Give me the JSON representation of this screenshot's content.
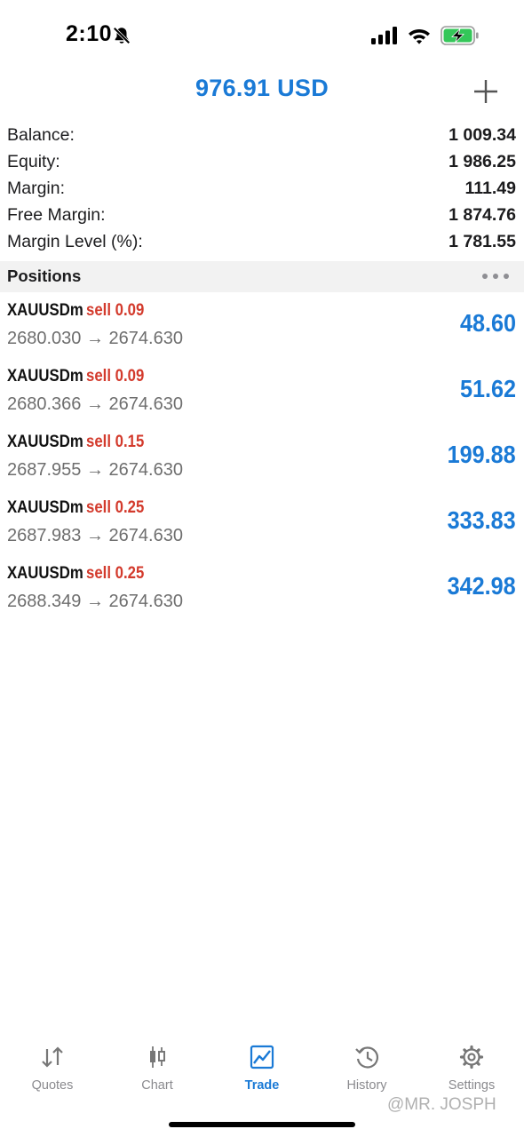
{
  "status_bar": {
    "time": "2:10"
  },
  "header": {
    "title": "976.91 USD"
  },
  "summary": [
    {
      "label": "Balance:",
      "value": "1 009.34"
    },
    {
      "label": "Equity:",
      "value": "1 986.25"
    },
    {
      "label": "Margin:",
      "value": "111.49"
    },
    {
      "label": "Free Margin:",
      "value": "1 874.76"
    },
    {
      "label": "Margin Level (%):",
      "value": "1 781.55"
    }
  ],
  "positions": {
    "title": "Positions",
    "items": [
      {
        "symbol": "XAUUSDm",
        "side": "sell 0.09",
        "prices": "2680.030 → 2674.630",
        "profit": "48.60"
      },
      {
        "symbol": "XAUUSDm",
        "side": "sell 0.09",
        "prices": "2680.366 → 2674.630",
        "profit": "51.62"
      },
      {
        "symbol": "XAUUSDm",
        "side": "sell 0.15",
        "prices": "2687.955 → 2674.630",
        "profit": "199.88"
      },
      {
        "symbol": "XAUUSDm",
        "side": "sell 0.25",
        "prices": "2687.983 → 2674.630",
        "profit": "333.83"
      },
      {
        "symbol": "XAUUSDm",
        "side": "sell 0.25",
        "prices": "2688.349 → 2674.630",
        "profit": "342.98"
      }
    ]
  },
  "tabs": [
    {
      "label": "Quotes",
      "icon": "quotes-icon"
    },
    {
      "label": "Chart",
      "icon": "chart-icon"
    },
    {
      "label": "Trade",
      "icon": "trade-icon",
      "active": true
    },
    {
      "label": "History",
      "icon": "history-icon"
    },
    {
      "label": "Settings",
      "icon": "settings-icon"
    }
  ],
  "watermark": "@MR. JOSPH",
  "colors": {
    "accent": "#1a7ad6",
    "sell": "#d33a2c",
    "muted": "#8a8a8e"
  }
}
